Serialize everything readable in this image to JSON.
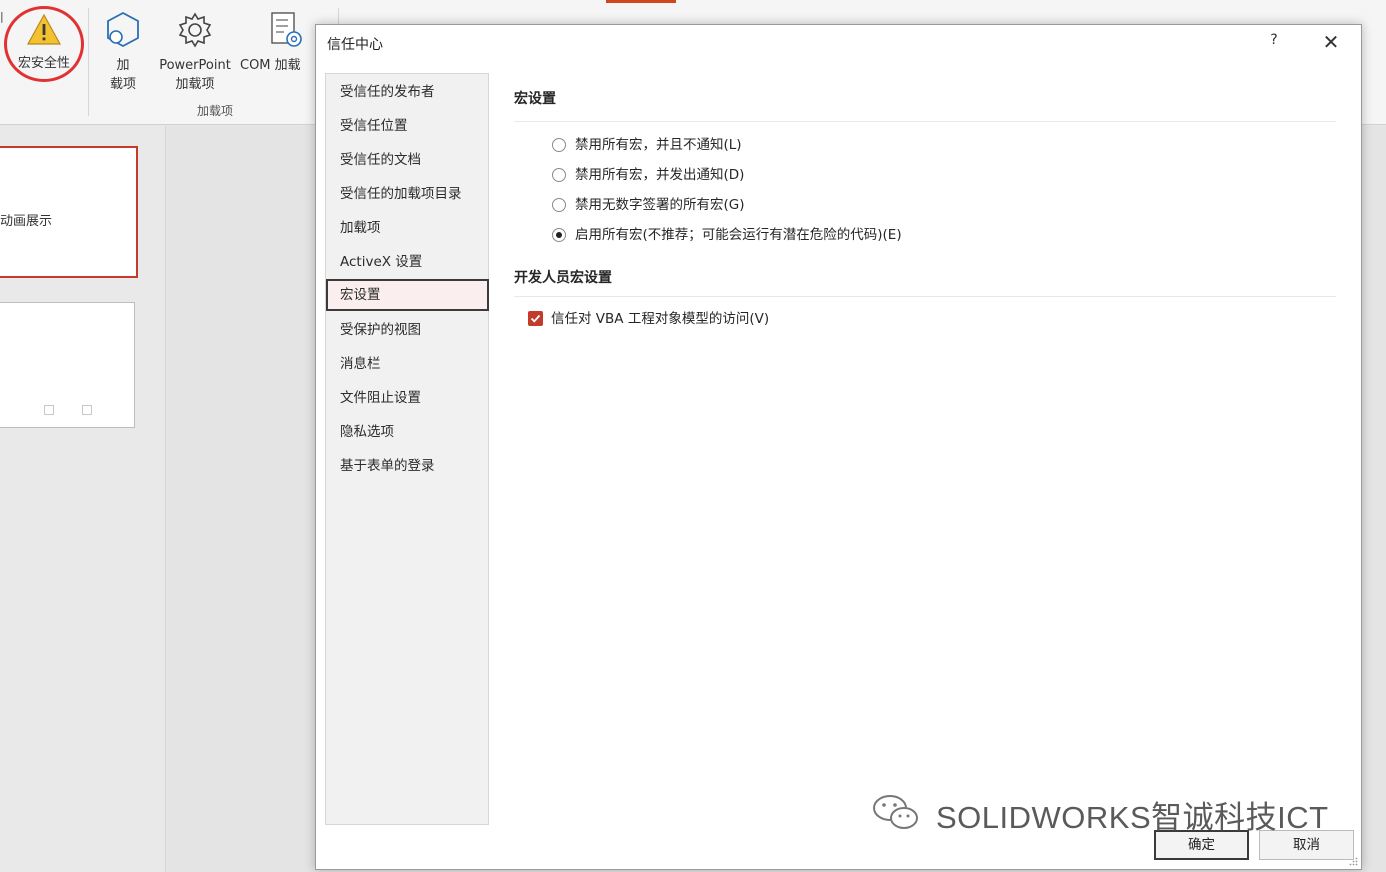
{
  "ribbon": {
    "macro_security_label": "宏安全性",
    "addins_label_line1": "加",
    "addins_label_line2": "载项",
    "powerpoint_addins_line1": "PowerPoint",
    "powerpoint_addins_line2": "加载项",
    "com_addins_label": "COM 加载",
    "group_label": "加载项"
  },
  "slides": {
    "slide1_title": "动画展示"
  },
  "dialog": {
    "title": "信任中心",
    "help_label": "?",
    "close_label": "✕",
    "nav_items": [
      {
        "label": "受信任的发布者"
      },
      {
        "label": "受信任位置"
      },
      {
        "label": "受信任的文档"
      },
      {
        "label": "受信任的加载项目录"
      },
      {
        "label": "加载项"
      },
      {
        "label": "ActiveX 设置"
      },
      {
        "label": "宏设置"
      },
      {
        "label": "受保护的视图"
      },
      {
        "label": "消息栏"
      },
      {
        "label": "文件阻止设置"
      },
      {
        "label": "隐私选项"
      },
      {
        "label": "基于表单的登录"
      }
    ],
    "selected_nav": "宏设置",
    "macro_section": {
      "title": "宏设置",
      "options": [
        {
          "label": "禁用所有宏，并且不通知(L)",
          "selected": false
        },
        {
          "label": "禁用所有宏，并发出通知(D)",
          "selected": false
        },
        {
          "label": "禁用无数字签署的所有宏(G)",
          "selected": false
        },
        {
          "label": "启用所有宏(不推荐；可能会运行有潜在危险的代码)(E)",
          "selected": true
        }
      ]
    },
    "developer_section": {
      "title": "开发人员宏设置",
      "vba_access_label": "信任对 VBA 工程对象模型的访问(V)",
      "vba_access_checked": true
    },
    "ok_label": "确定",
    "cancel_label": "取消"
  },
  "watermark": {
    "text": "SOLIDWORKS智诚科技ICT"
  },
  "colors": {
    "accent_red": "#c33b2c",
    "highlight_circle": "#e03232",
    "warning_yellow": "#f2c230"
  }
}
